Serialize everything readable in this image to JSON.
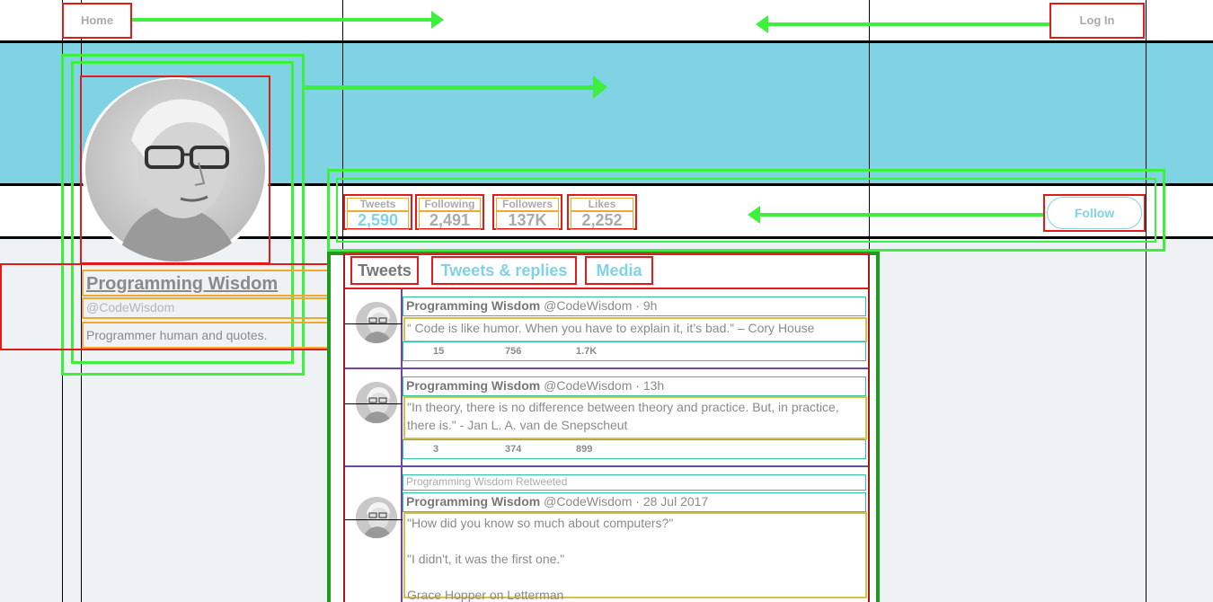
{
  "nav": {
    "home_label": "Home",
    "login_label": "Log In"
  },
  "colors": {
    "banner": "#7fd3e3",
    "accent": "#7fd3e3",
    "annotation_red": "#e11a1a",
    "annotation_green": "#3ef03e"
  },
  "profile": {
    "name": "Programming Wisdom",
    "handle": "@CodeWisdom",
    "bio": "Programmer human and quotes.",
    "avatar": "portrait-avatar"
  },
  "stats": [
    {
      "label": "Tweets",
      "value": "2,590"
    },
    {
      "label": "Following",
      "value": "2,491"
    },
    {
      "label": "Followers",
      "value": "137K"
    },
    {
      "label": "Likes",
      "value": "2,252"
    }
  ],
  "follow_label": "Follow",
  "tabs": [
    {
      "label": "Tweets",
      "active": true
    },
    {
      "label": "Tweets & replies",
      "active": false
    },
    {
      "label": "Media",
      "active": false
    }
  ],
  "tweets": [
    {
      "retweet_note": "",
      "author": "Programming Wisdom",
      "handle": "@CodeWisdom",
      "time": "· 9h",
      "text": "“ Code is like humor. When you have to explain it, it’s bad.” – Cory House",
      "replies": "15",
      "retweets": "756",
      "likes": "1.7K"
    },
    {
      "retweet_note": "",
      "author": "Programming Wisdom",
      "handle": "@CodeWisdom",
      "time": "· 13h",
      "text": "\"In theory, there is no difference between theory and practice. But, in practice, there is.\" - Jan L. A. van de Snepscheut",
      "replies": "3",
      "retweets": "374",
      "likes": "899"
    },
    {
      "retweet_note": "Programming Wisdom Retweeted",
      "author": "Programming Wisdom",
      "handle": "@CodeWisdom",
      "time": "· 28 Jul 2017",
      "text": "\"How did you know so much about computers?\"\n\n\"I didn't, it was the first one.\"\n\nGrace Hopper on Letterman"
    }
  ]
}
